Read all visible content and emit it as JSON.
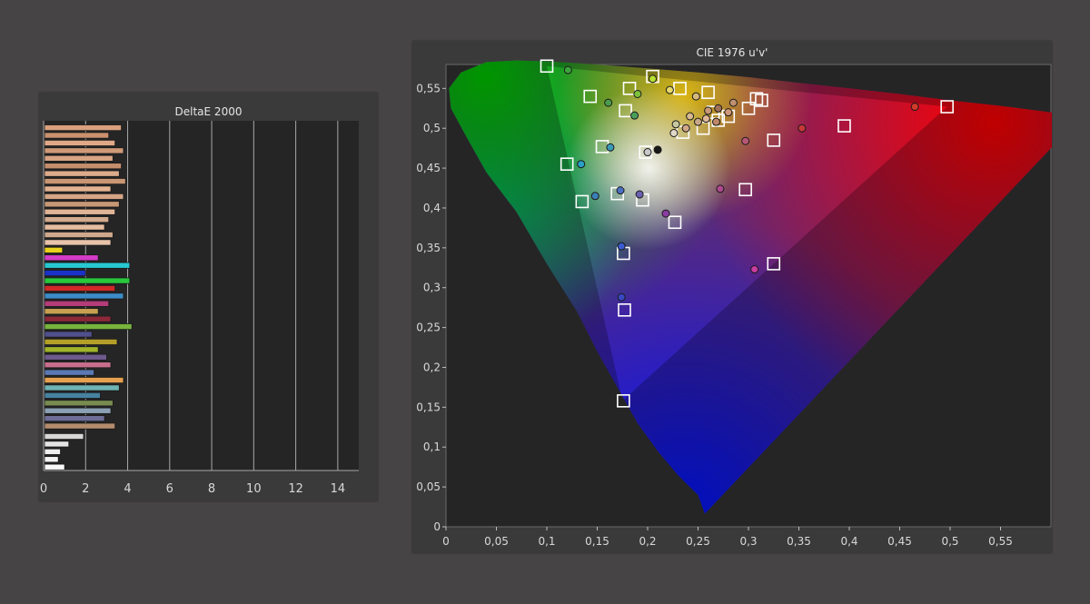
{
  "chart_data": [
    {
      "type": "bar",
      "orientation": "horizontal",
      "title": "DeltaE 2000",
      "xlim": [
        0,
        15
      ],
      "xticks": [
        0,
        2,
        4,
        6,
        8,
        10,
        12,
        14
      ],
      "xtick_labels": [
        "0",
        "2",
        "4",
        "6",
        "8",
        "10",
        "12",
        "14"
      ],
      "grid": true,
      "bars": [
        {
          "value": 3.7,
          "color": "#d9a17e"
        },
        {
          "value": 3.1,
          "color": "#c9916e"
        },
        {
          "value": 3.4,
          "color": "#e0a887"
        },
        {
          "value": 3.8,
          "color": "#cf9a78"
        },
        {
          "value": 3.3,
          "color": "#d8a483"
        },
        {
          "value": 3.7,
          "color": "#c48e6d"
        },
        {
          "value": 3.6,
          "color": "#ddab8c"
        },
        {
          "value": 3.9,
          "color": "#c99673"
        },
        {
          "value": 3.2,
          "color": "#e3b291"
        },
        {
          "value": 3.8,
          "color": "#d5a586"
        },
        {
          "value": 3.6,
          "color": "#c79876"
        },
        {
          "value": 3.4,
          "color": "#dfb496"
        },
        {
          "value": 3.1,
          "color": "#d2aa8e"
        },
        {
          "value": 2.9,
          "color": "#e6bda0"
        },
        {
          "value": 3.3,
          "color": "#cfa98e"
        },
        {
          "value": 3.2,
          "color": "#e8c3aa"
        },
        {
          "value": 0.9,
          "color": "#e8d21c"
        },
        {
          "value": 2.6,
          "color": "#d43cc8"
        },
        {
          "value": 4.1,
          "color": "#28c8d2"
        },
        {
          "value": 2.0,
          "color": "#1a32c8"
        },
        {
          "value": 4.1,
          "color": "#28c83c"
        },
        {
          "value": 3.4,
          "color": "#d22828"
        },
        {
          "value": 3.8,
          "color": "#3c8cc8"
        },
        {
          "value": 3.1,
          "color": "#b43c78"
        },
        {
          "value": 2.6,
          "color": "#c8a050"
        },
        {
          "value": 3.2,
          "color": "#8c2838"
        },
        {
          "value": 4.2,
          "color": "#78b43c"
        },
        {
          "value": 2.3,
          "color": "#50508c"
        },
        {
          "value": 3.5,
          "color": "#b4a028"
        },
        {
          "value": 2.6,
          "color": "#a0b428"
        },
        {
          "value": 3.0,
          "color": "#6e5a8c"
        },
        {
          "value": 3.2,
          "color": "#c86e8c"
        },
        {
          "value": 2.4,
          "color": "#5a78b4"
        },
        {
          "value": 3.8,
          "color": "#e6a050"
        },
        {
          "value": 3.6,
          "color": "#6eb4b4"
        },
        {
          "value": 2.7,
          "color": "#4682a0"
        },
        {
          "value": 3.3,
          "color": "#788c50"
        },
        {
          "value": 3.2,
          "color": "#8ca0b4"
        },
        {
          "value": 2.9,
          "color": "#6e6e96"
        },
        {
          "value": 3.4,
          "color": "#b48c6e"
        },
        {
          "value": 1.9,
          "color": "#d8d8d8"
        },
        {
          "value": 1.2,
          "color": "#e4e4e4"
        },
        {
          "value": 0.8,
          "color": "#eeeeee"
        },
        {
          "value": 0.7,
          "color": "#f4f4f4"
        },
        {
          "value": 1.0,
          "color": "#fafafa"
        }
      ]
    },
    {
      "type": "scatter",
      "title": "CIE 1976 u'v'",
      "xlim": [
        0,
        0.6
      ],
      "ylim": [
        0,
        0.58
      ],
      "xticks": [
        0,
        0.05,
        0.1,
        0.15,
        0.2,
        0.25,
        0.3,
        0.35,
        0.4,
        0.45,
        0.5,
        0.55
      ],
      "xtick_labels": [
        "0",
        "0,05",
        "0,1",
        "0,15",
        "0,2",
        "0,25",
        "0,3",
        "0,35",
        "0,4",
        "0,45",
        "0,5",
        "0,55"
      ],
      "yticks": [
        0,
        0.05,
        0.1,
        0.15,
        0.2,
        0.25,
        0.3,
        0.35,
        0.4,
        0.45,
        0.5,
        0.55
      ],
      "ytick_labels": [
        "0",
        "0,05",
        "0,1",
        "0,15",
        "0,2",
        "0,25",
        "0,3",
        "0,35",
        "0,4",
        "0,45",
        "0,5",
        "0,55"
      ],
      "gamut_triangle": [
        [
          0.497,
          0.527
        ],
        [
          0.1,
          0.578
        ],
        [
          0.175,
          0.158
        ]
      ],
      "targets": [
        [
          0.1,
          0.578
        ],
        [
          0.205,
          0.565
        ],
        [
          0.143,
          0.54
        ],
        [
          0.182,
          0.55
        ],
        [
          0.232,
          0.55
        ],
        [
          0.26,
          0.545
        ],
        [
          0.308,
          0.537
        ],
        [
          0.313,
          0.535
        ],
        [
          0.3,
          0.525
        ],
        [
          0.178,
          0.522
        ],
        [
          0.265,
          0.52
        ],
        [
          0.28,
          0.515
        ],
        [
          0.255,
          0.5
        ],
        [
          0.235,
          0.495
        ],
        [
          0.27,
          0.51
        ],
        [
          0.395,
          0.503
        ],
        [
          0.497,
          0.527
        ],
        [
          0.325,
          0.485
        ],
        [
          0.155,
          0.477
        ],
        [
          0.198,
          0.47
        ],
        [
          0.12,
          0.455
        ],
        [
          0.297,
          0.423
        ],
        [
          0.17,
          0.418
        ],
        [
          0.135,
          0.408
        ],
        [
          0.195,
          0.41
        ],
        [
          0.227,
          0.382
        ],
        [
          0.176,
          0.343
        ],
        [
          0.325,
          0.33
        ],
        [
          0.177,
          0.272
        ],
        [
          0.176,
          0.158
        ]
      ],
      "measured": [
        {
          "u": 0.121,
          "v": 0.573,
          "c": "#3aa43a"
        },
        {
          "u": 0.205,
          "v": 0.562,
          "c": "#b8e030"
        },
        {
          "u": 0.19,
          "v": 0.543,
          "c": "#7cc03c"
        },
        {
          "u": 0.222,
          "v": 0.548,
          "c": "#e6d86a"
        },
        {
          "u": 0.248,
          "v": 0.54,
          "c": "#d6b87a"
        },
        {
          "u": 0.161,
          "v": 0.532,
          "c": "#4a9c4a"
        },
        {
          "u": 0.187,
          "v": 0.516,
          "c": "#4aa05a"
        },
        {
          "u": 0.285,
          "v": 0.532,
          "c": "#c09070"
        },
        {
          "u": 0.26,
          "v": 0.522,
          "c": "#c89878"
        },
        {
          "u": 0.27,
          "v": 0.525,
          "c": "#a07058"
        },
        {
          "u": 0.28,
          "v": 0.52,
          "c": "#d09878"
        },
        {
          "u": 0.242,
          "v": 0.515,
          "c": "#d8b890"
        },
        {
          "u": 0.25,
          "v": 0.508,
          "c": "#c8a888"
        },
        {
          "u": 0.258,
          "v": 0.512,
          "c": "#e0b898"
        },
        {
          "u": 0.238,
          "v": 0.5,
          "c": "#d0a888"
        },
        {
          "u": 0.228,
          "v": 0.505,
          "c": "#c8c8a0"
        },
        {
          "u": 0.226,
          "v": 0.494,
          "c": "#e0d8c8"
        },
        {
          "u": 0.268,
          "v": 0.508,
          "c": "#c08868"
        },
        {
          "u": 0.353,
          "v": 0.5,
          "c": "#c83838"
        },
        {
          "u": 0.297,
          "v": 0.484,
          "c": "#b85878"
        },
        {
          "u": 0.465,
          "v": 0.527,
          "c": "#d23a2a"
        },
        {
          "u": 0.163,
          "v": 0.476,
          "c": "#3a9ab8"
        },
        {
          "u": 0.21,
          "v": 0.473,
          "c": "#181818"
        },
        {
          "u": 0.2,
          "v": 0.47,
          "c": "#c8c8c8"
        },
        {
          "u": 0.134,
          "v": 0.455,
          "c": "#28a0c8"
        },
        {
          "u": 0.272,
          "v": 0.424,
          "c": "#b04890"
        },
        {
          "u": 0.173,
          "v": 0.422,
          "c": "#4a70c0"
        },
        {
          "u": 0.148,
          "v": 0.415,
          "c": "#3a80b8"
        },
        {
          "u": 0.192,
          "v": 0.417,
          "c": "#6a60b0"
        },
        {
          "u": 0.218,
          "v": 0.393,
          "c": "#8a3ca0"
        },
        {
          "u": 0.174,
          "v": 0.352,
          "c": "#3a5ad0"
        },
        {
          "u": 0.306,
          "v": 0.323,
          "c": "#c83ca0"
        },
        {
          "u": 0.174,
          "v": 0.288,
          "c": "#3848c0"
        }
      ]
    }
  ]
}
